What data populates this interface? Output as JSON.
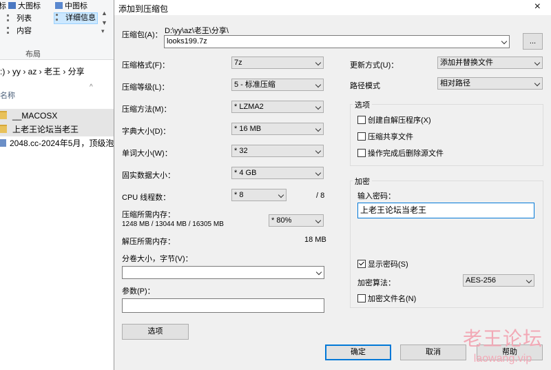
{
  "explorer": {
    "ribbon": {
      "items": [
        {
          "label": "大图标"
        },
        {
          "label": "中图标"
        },
        {
          "label": "列表"
        },
        {
          "label": "详细信息"
        },
        {
          "label": "内容"
        }
      ],
      "partial_left": "标",
      "group_label": "布局"
    },
    "address": {
      "path": ":) › yy › az › 老王 › 分享"
    },
    "column_header": "名称",
    "files": [
      {
        "name": "__MACOSX",
        "type": "folder"
      },
      {
        "name": "上老王论坛当老王",
        "type": "folder"
      },
      {
        "name": "2048.cc-2024年5月，顶级泡",
        "type": "archive"
      }
    ]
  },
  "dialog": {
    "title": "添加到压缩包",
    "close_icon": "×",
    "archive": {
      "label": "压缩包(A)：",
      "dir": "D:\\yy\\az\\老王\\分享\\",
      "value": "looks199.7z",
      "browse_label": "..."
    },
    "format": {
      "label": "压缩格式(F)：",
      "value": "7z"
    },
    "level": {
      "label": "压缩等级(L)：",
      "value": "5 - 标准压缩"
    },
    "method": {
      "label": "压缩方法(M)：",
      "value": "* LZMA2"
    },
    "dict": {
      "label": "字典大小(D)：",
      "value": "* 16 MB"
    },
    "word": {
      "label": "单词大小(W)：",
      "value": "* 32"
    },
    "solid": {
      "label": "固实数据大小：",
      "value": "* 4 GB"
    },
    "threads": {
      "label": "CPU 线程数：",
      "value": "* 8",
      "max": "/ 8"
    },
    "memory": {
      "label": "压缩所需内存：",
      "detail": "1248 MB / 13044 MB / 16305 MB",
      "value": "* 80%"
    },
    "decomp": {
      "label": "解压所需内存：",
      "value": "18 MB"
    },
    "split": {
      "label": "分卷大小，字节(V)：",
      "value": ""
    },
    "params": {
      "label": "参数(P)：",
      "value": ""
    },
    "options_button": "选项",
    "update": {
      "label": "更新方式(U)：",
      "value": "添加并替换文件"
    },
    "path_mode": {
      "label": "路径模式",
      "value": "相对路径"
    },
    "options_group": {
      "title": "选项",
      "sfx": "创建自解压程序(X)",
      "shared": "压缩共享文件",
      "delete": "操作完成后删除源文件"
    },
    "encryption": {
      "title": "加密",
      "password_label": "输入密码：",
      "password": "上老王论坛当老王",
      "show_password": "显示密码(S)",
      "method_label": "加密算法：",
      "method": "AES-256",
      "encrypt_names": "加密文件名(N)"
    },
    "buttons": {
      "ok": "确定",
      "cancel": "取消",
      "help": "帮助"
    }
  },
  "watermark": {
    "line1": "老王论坛",
    "line2": "laowang.vip"
  }
}
